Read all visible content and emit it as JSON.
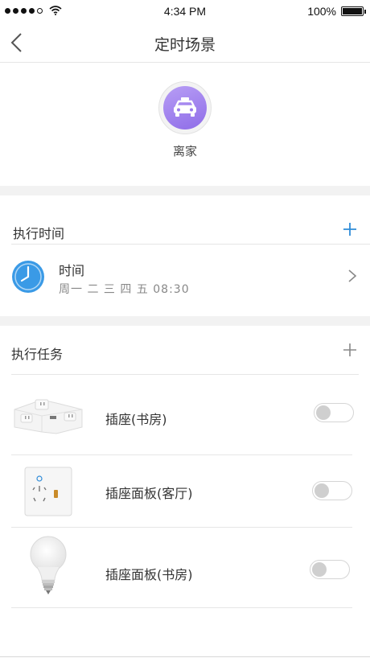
{
  "status_bar": {
    "time": "4:34 PM",
    "battery": "100%",
    "battery_level": 1.0,
    "signal_bars_filled": 4,
    "signal_bars_total": 5
  },
  "nav": {
    "title": "定时场景",
    "back_icon": "chevron-left-icon"
  },
  "scene": {
    "name": "离家",
    "icon": "car-icon",
    "icon_color": "#9a7bec"
  },
  "schedule": {
    "section_title": "执行时间",
    "add_icon": "plus-icon",
    "add_color": "#2f8cd8",
    "item": {
      "title": "时间",
      "description": "周一  二  三  四  五   08:30",
      "icon": "clock-icon",
      "icon_color": "#3a9ae6"
    }
  },
  "tasks": {
    "section_title": "执行任务",
    "add_icon": "plus-icon",
    "add_color": "#888888",
    "items": [
      {
        "label": "插座(书房)",
        "image": "power-strip-image",
        "enabled": false
      },
      {
        "label": "插座面板(客厅)",
        "image": "wall-socket-image",
        "enabled": false
      },
      {
        "label": "插座面板(书房)",
        "image": "light-bulb-image",
        "enabled": false
      }
    ]
  }
}
